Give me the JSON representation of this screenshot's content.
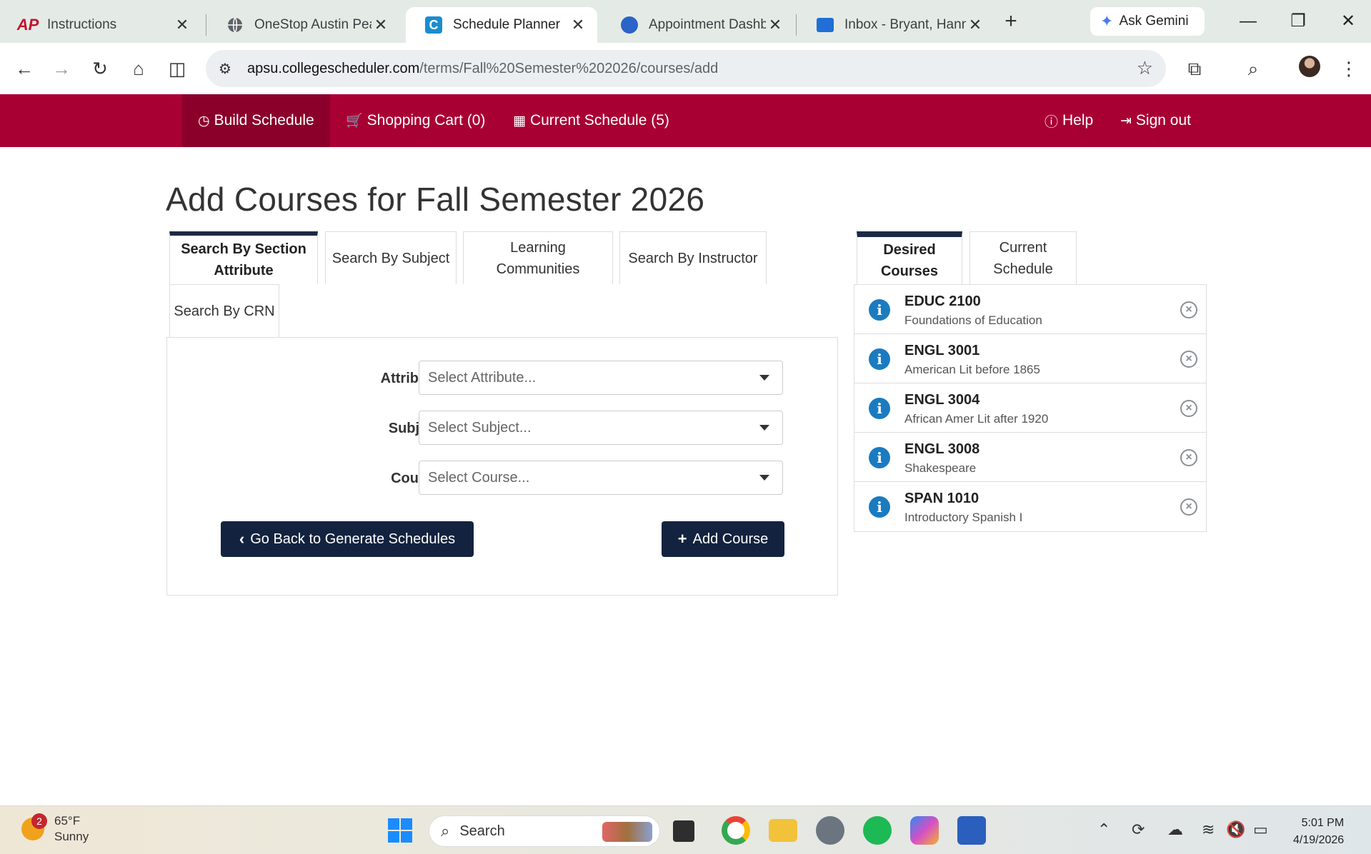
{
  "browser": {
    "tabs": [
      {
        "title": "Instructions",
        "favicon": "ap-logo-icon"
      },
      {
        "title": "OneStop Austin Peay",
        "favicon": "globe-icon"
      },
      {
        "title": "Schedule Planner",
        "favicon": "collegescheduler-icon"
      },
      {
        "title": "Appointment Dashbo",
        "favicon": "appointment-icon"
      },
      {
        "title": "Inbox - Bryant, Hanna",
        "favicon": "outlook-icon"
      }
    ],
    "active_tab": 2,
    "ask_gemini": "Ask Gemini",
    "url_host": "apsu.collegescheduler.com",
    "url_path": "/terms/Fall%20Semester%202026/courses/add"
  },
  "appnav": {
    "build_schedule": "Build Schedule",
    "shopping_cart": "Shopping Cart (0)",
    "current_schedule": "Current Schedule (5)",
    "help": "Help",
    "sign_out": "Sign out"
  },
  "main": {
    "title": "Add Courses for Fall Semester 2026",
    "search_tabs": {
      "section_attribute": "Search By Section Attribute",
      "subject": "Search By Subject",
      "learning_communities": "Learning Communities",
      "instructor": "Search By Instructor",
      "crn": "Search By CRN"
    },
    "form": {
      "attribute_label": "Attribute",
      "attribute_placeholder": "Select Attribute...",
      "subject_label": "Subject",
      "subject_placeholder": "Select Subject...",
      "course_label": "Course",
      "course_placeholder": "Select Course...",
      "back_button": "Go Back to Generate Schedules",
      "add_button": "Add Course"
    }
  },
  "right": {
    "tabs": {
      "desired": "Desired Courses",
      "current": "Current Schedule"
    },
    "courses": [
      {
        "code": "EDUC 2100",
        "name": "Foundations of Education"
      },
      {
        "code": "ENGL 3001",
        "name": "American Lit before 1865"
      },
      {
        "code": "ENGL 3004",
        "name": "African Amer Lit after 1920"
      },
      {
        "code": "ENGL 3008",
        "name": "Shakespeare"
      },
      {
        "code": "SPAN 1010",
        "name": "Introductory Spanish I"
      }
    ]
  },
  "taskbar": {
    "weather_temp": "65°F",
    "weather_cond": "Sunny",
    "weather_badge": "2",
    "search": "Search",
    "time": "5:01 PM",
    "date": "4/19/2026"
  }
}
